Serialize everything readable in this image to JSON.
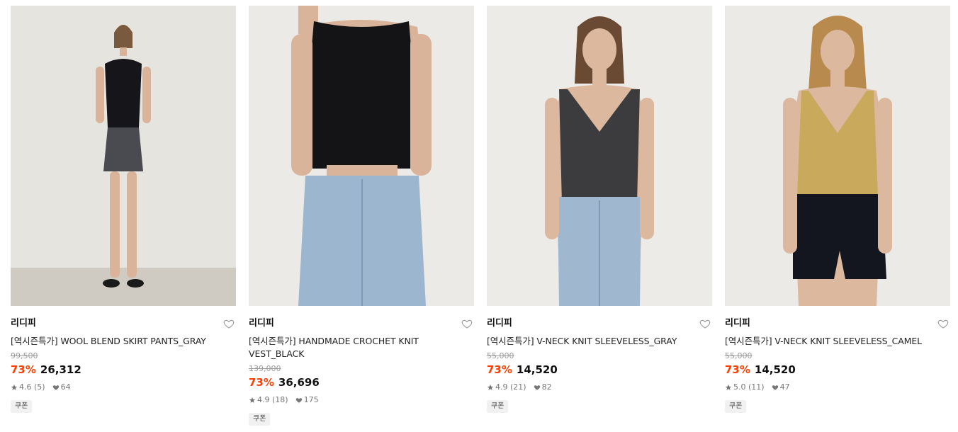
{
  "products": [
    {
      "brand": "리디피",
      "name": "[역시즌특가] WOOL BLEND SKIRT PANTS_GRAY",
      "original_price": "99,500",
      "discount": "73%",
      "price": "26,312",
      "rating": "4.6 (5)",
      "likes": "64",
      "tag": "쿠폰",
      "image": {
        "top_color": "#16161a",
        "bottom_color": "#4a4b50",
        "bg_color": "#e6e4df",
        "floor_color": "#cfcbc3"
      }
    },
    {
      "brand": "리디피",
      "name": "[역시즌특가] HANDMADE CROCHET KNIT VEST_BLACK",
      "original_price": "139,000",
      "discount": "73%",
      "price": "36,696",
      "rating": "4.9 (18)",
      "likes": "175",
      "tag": "쿠폰",
      "image": {
        "top_color": "#141416",
        "bottom_color": "#9db6cf",
        "bg_color": "#ebeae6",
        "floor_color": "#ebeae6"
      }
    },
    {
      "brand": "리디피",
      "name": "[역시즌특가] V-NECK KNIT SLEEVELESS_GRAY",
      "original_price": "55,000",
      "discount": "73%",
      "price": "14,520",
      "rating": "4.9 (21)",
      "likes": "82",
      "tag": "쿠폰",
      "image": {
        "top_color": "#3c3c3e",
        "bottom_color": "#9fb7cf",
        "bg_color": "#ecebe7",
        "floor_color": "#ecebe7"
      }
    },
    {
      "brand": "리디피",
      "name": "[역시즌특가] V-NECK KNIT SLEEVELESS_CAMEL",
      "original_price": "55,000",
      "discount": "73%",
      "price": "14,520",
      "rating": "5.0 (11)",
      "likes": "47",
      "tag": "쿠폰",
      "image": {
        "top_color": "#c9a95c",
        "bottom_color": "#14161f",
        "bg_color": "#ebeae6",
        "floor_color": "#ebeae6"
      }
    }
  ],
  "icons": {
    "wishlist": "heart-outline-icon",
    "rating": "star-icon",
    "likes": "heart-filled-icon"
  },
  "colors": {
    "discount": "#ff3d00",
    "original_price": "#9a9a9a",
    "meta": "#777777"
  }
}
